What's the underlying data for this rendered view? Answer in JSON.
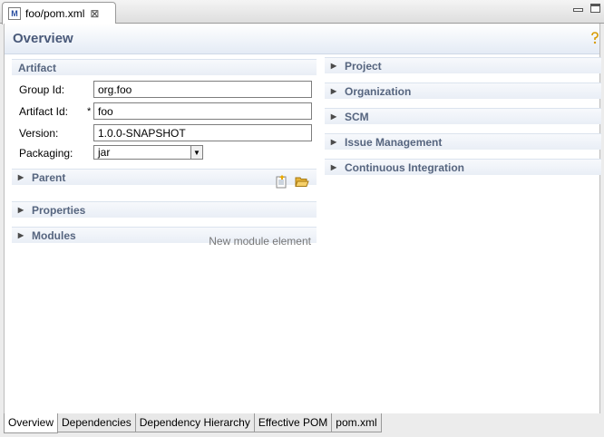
{
  "editor_tab": {
    "title": "foo/pom.xml",
    "close": "⊠",
    "icon_letter": "M"
  },
  "header": {
    "title": "Overview"
  },
  "artifact": {
    "title": "Artifact",
    "group_id": {
      "label": "Group Id:",
      "value": "org.foo"
    },
    "artifact_id": {
      "label": "Artifact Id:",
      "required_mark": "*",
      "value": "foo"
    },
    "version": {
      "label": "Version:",
      "value": "1.0.0-SNAPSHOT"
    },
    "packaging": {
      "label": "Packaging:",
      "value": "jar"
    }
  },
  "left_sections": {
    "parent": "Parent",
    "properties": "Properties",
    "modules": "Modules",
    "modules_hint": "New module element"
  },
  "right_sections": [
    "Project",
    "Organization",
    "SCM",
    "Issue Management",
    "Continuous Integration"
  ],
  "bottom_tabs": [
    "Overview",
    "Dependencies",
    "Dependency Hierarchy",
    "Effective POM",
    "pom.xml"
  ],
  "icons": {
    "chevron": "chevron-right-icon",
    "open_folder": "folder-open-icon",
    "select_parent": "select-pom-icon",
    "help": "help-icon"
  },
  "colors": {
    "section_title": "#56657f",
    "page_title": "#4a5a7a"
  }
}
